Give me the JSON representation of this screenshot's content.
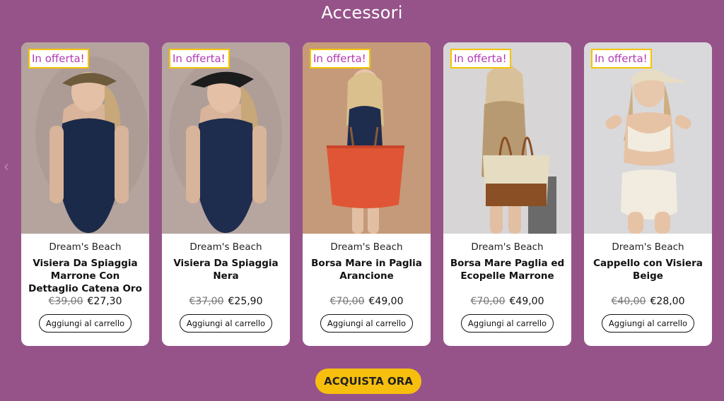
{
  "section": {
    "title": "Accessori"
  },
  "carousel": {
    "prev_icon": "chevron-left-icon"
  },
  "products": [
    {
      "badge": "In offerta!",
      "brand": "Dream's Beach",
      "name": "Visiera Da Spiaggia Marrone Con Dettaglio Catena Oro",
      "old_price": "€39,00",
      "price": "€27,30",
      "button": "Aggiungi al carrello",
      "bg": "#b5a49e",
      "accent": "#1c2a4a",
      "hat": "#6e5b3c"
    },
    {
      "badge": "In offerta!",
      "brand": "Dream's Beach",
      "name": "Visiera Da Spiaggia Nera",
      "old_price": "€37,00",
      "price": "€25,90",
      "button": "Aggiungi al carrello",
      "bg": "#b7a6a0",
      "accent": "#1e2c4e",
      "hat": "#1c1c1c"
    },
    {
      "badge": "In offerta!",
      "brand": "Dream's Beach",
      "name": "Borsa Mare in Paglia Arancione",
      "old_price": "€70,00",
      "price": "€49,00",
      "button": "Aggiungi al carrello",
      "bg": "#c59a7a",
      "accent": "#e05535",
      "hat": ""
    },
    {
      "badge": "In offerta!",
      "brand": "Dream's Beach",
      "name": "Borsa Mare Paglia ed Ecopelle Marrone",
      "old_price": "€70,00",
      "price": "€49,00",
      "button": "Aggiungi al carrello",
      "bg": "#d7d5d6",
      "accent": "#b89a72",
      "hat": ""
    },
    {
      "badge": "In offerta!",
      "brand": "Dream's Beach",
      "name": "Cappello con Visiera Beige",
      "old_price": "€40,00",
      "price": "€28,00",
      "button": "Aggiungi al carrello",
      "bg": "#d9d9db",
      "accent": "#f1ecdf",
      "hat": "#e7dcc4"
    }
  ],
  "cta": {
    "label": "ACQUISTA ORA"
  }
}
